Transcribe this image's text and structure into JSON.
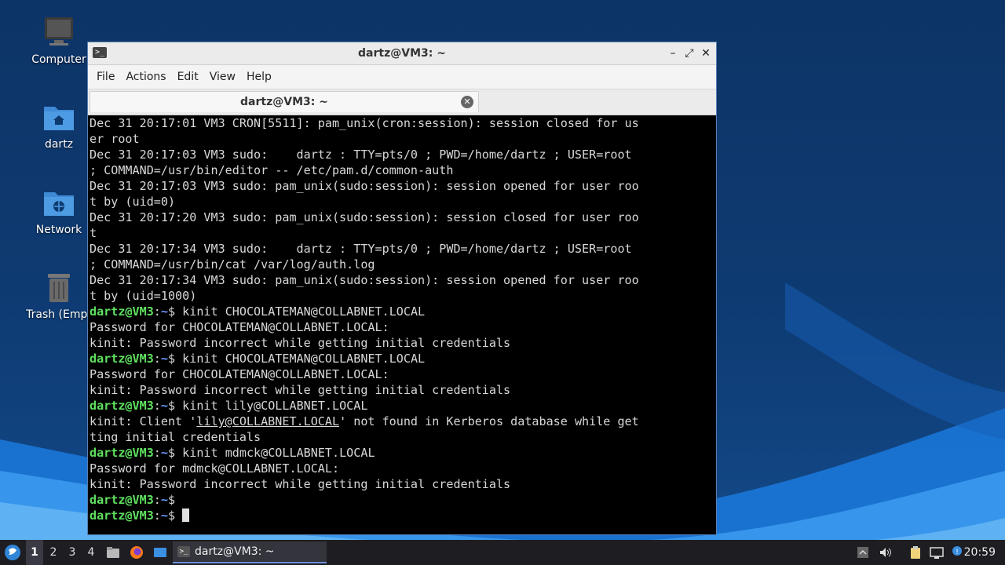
{
  "desktop": {
    "icons": [
      {
        "label": "Computer",
        "icon": "computer-icon"
      },
      {
        "label": "dartz",
        "icon": "home-folder-icon"
      },
      {
        "label": "Network",
        "icon": "network-folder-icon"
      },
      {
        "label": "Trash (Empt",
        "icon": "trash-icon"
      }
    ]
  },
  "window": {
    "title": "dartz@VM3: ~",
    "menu": [
      "File",
      "Actions",
      "Edit",
      "View",
      "Help"
    ],
    "tab_label": "dartz@VM3: ~",
    "controls": {
      "minimize": "–",
      "maximize": "⤢",
      "close": "✕"
    }
  },
  "terminal": {
    "prompt_user": "dartz@VM3",
    "prompt_sep": ":",
    "prompt_path": "~",
    "prompt_sym": "$ ",
    "lines": [
      {
        "kind": "out",
        "text": "Dec 31 20:17:01 VM3 CRON[5511]: pam_unix(cron:session): session closed for us"
      },
      {
        "kind": "out",
        "text": "er root"
      },
      {
        "kind": "out",
        "text": "Dec 31 20:17:03 VM3 sudo:    dartz : TTY=pts/0 ; PWD=/home/dartz ; USER=root"
      },
      {
        "kind": "out",
        "text": "; COMMAND=/usr/bin/editor -- /etc/pam.d/common-auth"
      },
      {
        "kind": "out",
        "text": "Dec 31 20:17:03 VM3 sudo: pam_unix(sudo:session): session opened for user roo"
      },
      {
        "kind": "out",
        "text": "t by (uid=0)"
      },
      {
        "kind": "out",
        "text": "Dec 31 20:17:20 VM3 sudo: pam_unix(sudo:session): session closed for user roo"
      },
      {
        "kind": "out",
        "text": "t"
      },
      {
        "kind": "out",
        "text": "Dec 31 20:17:34 VM3 sudo:    dartz : TTY=pts/0 ; PWD=/home/dartz ; USER=root"
      },
      {
        "kind": "out",
        "text": "; COMMAND=/usr/bin/cat /var/log/auth.log"
      },
      {
        "kind": "out",
        "text": "Dec 31 20:17:34 VM3 sudo: pam_unix(sudo:session): session opened for user roo"
      },
      {
        "kind": "out",
        "text": "t by (uid=1000)"
      },
      {
        "kind": "cmd",
        "text": "kinit CHOCOLATEMAN@COLLABNET.LOCAL"
      },
      {
        "kind": "out",
        "text": "Password for CHOCOLATEMAN@COLLABNET.LOCAL:"
      },
      {
        "kind": "out",
        "text": "kinit: Password incorrect while getting initial credentials"
      },
      {
        "kind": "cmd",
        "text": "kinit CHOCOLATEMAN@COLLABNET.LOCAL"
      },
      {
        "kind": "out",
        "text": "Password for CHOCOLATEMAN@COLLABNET.LOCAL:"
      },
      {
        "kind": "out",
        "text": "kinit: Password incorrect while getting initial credentials"
      },
      {
        "kind": "cmd",
        "text": "kinit lily@COLLABNET.LOCAL"
      },
      {
        "kind": "link",
        "pre": "kinit: Client '",
        "link": "lily@COLLABNET.LOCAL",
        "post": "' not found in Kerberos database while get"
      },
      {
        "kind": "out",
        "text": "ting initial credentials"
      },
      {
        "kind": "cmd",
        "text": "kinit mdmck@COLLABNET.LOCAL"
      },
      {
        "kind": "out",
        "text": "Password for mdmck@COLLABNET.LOCAL:"
      },
      {
        "kind": "out",
        "text": "kinit: Password incorrect while getting initial credentials"
      },
      {
        "kind": "cmd",
        "text": ""
      },
      {
        "kind": "cursor",
        "text": ""
      }
    ]
  },
  "taskbar": {
    "workspaces": [
      "1",
      "2",
      "3",
      "4"
    ],
    "active_workspace": "1",
    "task_label": "dartz@VM3: ~",
    "clock": "20:59"
  }
}
